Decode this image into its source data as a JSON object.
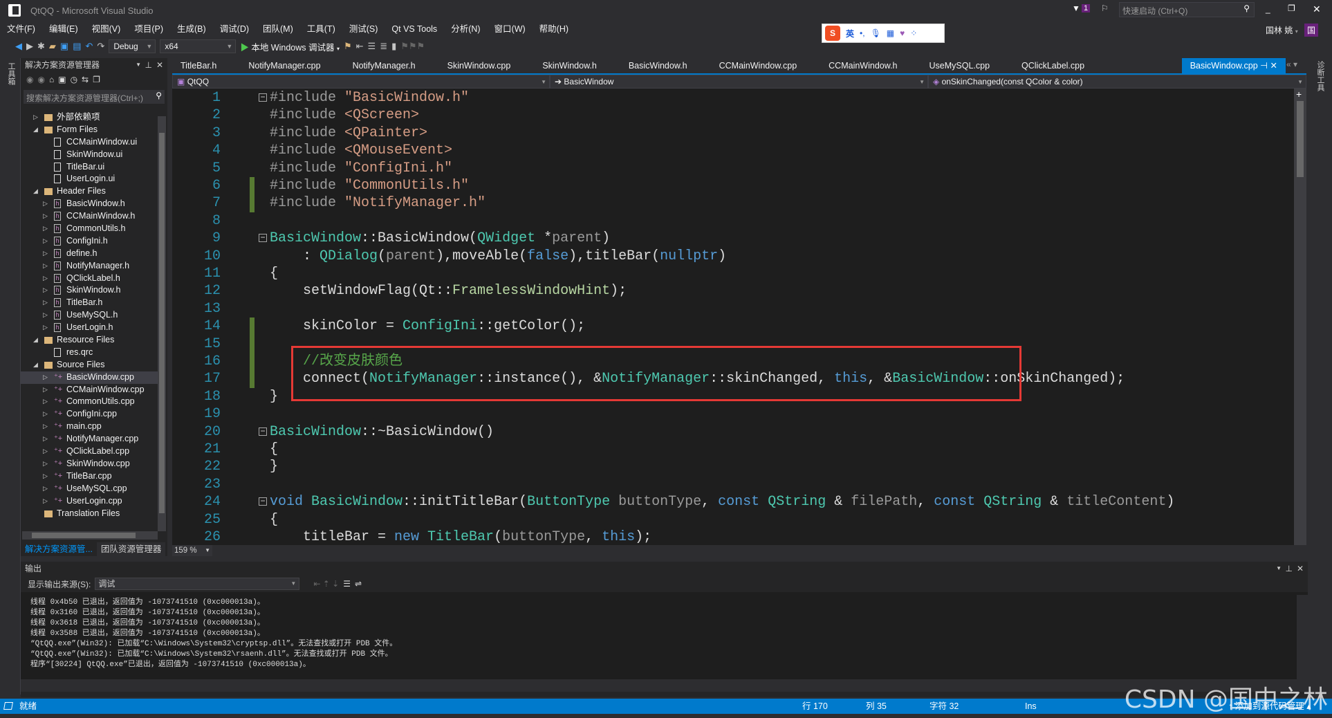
{
  "window": {
    "title": "QtQQ - Microsoft Visual Studio",
    "quick_launch_placeholder": "快速启动 (Ctrl+Q)",
    "notification_count": "1",
    "user": "国林 姚",
    "user_initial": "国"
  },
  "menu": [
    "文件(F)",
    "编辑(E)",
    "视图(V)",
    "项目(P)",
    "生成(B)",
    "调试(D)",
    "团队(M)",
    "工具(T)",
    "测试(S)",
    "Qt VS Tools",
    "分析(N)",
    "窗口(W)",
    "帮助(H)"
  ],
  "toolbar": {
    "config": "Debug",
    "platform": "x64",
    "run_label": "本地 Windows 调试器"
  },
  "ime": {
    "lang": "英"
  },
  "left_strip_label": "工具箱",
  "right_strip_label": "诊断工具",
  "solution_explorer": {
    "title": "解决方案资源管理器",
    "search_placeholder": "搜索解决方案资源管理器(Ctrl+;)",
    "items": [
      {
        "label": "外部依赖项",
        "level": 0,
        "type": "deps",
        "arrow": "closed"
      },
      {
        "label": "Form Files",
        "level": 0,
        "type": "folder",
        "arrow": "open"
      },
      {
        "label": "CCMainWindow.ui",
        "level": 1,
        "type": "ui",
        "arrow": ""
      },
      {
        "label": "SkinWindow.ui",
        "level": 1,
        "type": "ui",
        "arrow": ""
      },
      {
        "label": "TitleBar.ui",
        "level": 1,
        "type": "ui",
        "arrow": ""
      },
      {
        "label": "UserLogin.ui",
        "level": 1,
        "type": "ui",
        "arrow": ""
      },
      {
        "label": "Header Files",
        "level": 0,
        "type": "folder",
        "arrow": "open"
      },
      {
        "label": "BasicWindow.h",
        "level": 1,
        "type": "h",
        "arrow": "closed"
      },
      {
        "label": "CCMainWindow.h",
        "level": 1,
        "type": "h",
        "arrow": "closed"
      },
      {
        "label": "CommonUtils.h",
        "level": 1,
        "type": "h",
        "arrow": "closed"
      },
      {
        "label": "ConfigIni.h",
        "level": 1,
        "type": "h",
        "arrow": "closed"
      },
      {
        "label": "define.h",
        "level": 1,
        "type": "h",
        "arrow": "closed"
      },
      {
        "label": "NotifyManager.h",
        "level": 1,
        "type": "h",
        "arrow": "closed"
      },
      {
        "label": "QClickLabel.h",
        "level": 1,
        "type": "h",
        "arrow": "closed"
      },
      {
        "label": "SkinWindow.h",
        "level": 1,
        "type": "h",
        "arrow": "closed"
      },
      {
        "label": "TitleBar.h",
        "level": 1,
        "type": "h",
        "arrow": "closed"
      },
      {
        "label": "UseMySQL.h",
        "level": 1,
        "type": "h",
        "arrow": "closed"
      },
      {
        "label": "UserLogin.h",
        "level": 1,
        "type": "h",
        "arrow": "closed"
      },
      {
        "label": "Resource Files",
        "level": 0,
        "type": "folder",
        "arrow": "open"
      },
      {
        "label": "res.qrc",
        "level": 1,
        "type": "file",
        "arrow": ""
      },
      {
        "label": "Source Files",
        "level": 0,
        "type": "folder",
        "arrow": "open"
      },
      {
        "label": "BasicWindow.cpp",
        "level": 1,
        "type": "cpp",
        "arrow": "closed",
        "selected": true
      },
      {
        "label": "CCMainWindow.cpp",
        "level": 1,
        "type": "cpp",
        "arrow": "closed"
      },
      {
        "label": "CommonUtils.cpp",
        "level": 1,
        "type": "cpp",
        "arrow": "closed"
      },
      {
        "label": "ConfigIni.cpp",
        "level": 1,
        "type": "cpp",
        "arrow": "closed"
      },
      {
        "label": "main.cpp",
        "level": 1,
        "type": "cpp",
        "arrow": "closed"
      },
      {
        "label": "NotifyManager.cpp",
        "level": 1,
        "type": "cpp",
        "arrow": "closed"
      },
      {
        "label": "QClickLabel.cpp",
        "level": 1,
        "type": "cpp",
        "arrow": "closed"
      },
      {
        "label": "SkinWindow.cpp",
        "level": 1,
        "type": "cpp",
        "arrow": "closed"
      },
      {
        "label": "TitleBar.cpp",
        "level": 1,
        "type": "cpp",
        "arrow": "closed"
      },
      {
        "label": "UseMySQL.cpp",
        "level": 1,
        "type": "cpp",
        "arrow": "closed"
      },
      {
        "label": "UserLogin.cpp",
        "level": 1,
        "type": "cpp",
        "arrow": "closed"
      },
      {
        "label": "Translation Files",
        "level": 0,
        "type": "folder",
        "arrow": ""
      }
    ],
    "bottom_tabs": [
      "解决方案资源管...",
      "团队资源管理器"
    ]
  },
  "tabs": [
    "TitleBar.h",
    "NotifyManager.cpp",
    "NotifyManager.h",
    "SkinWindow.cpp",
    "SkinWindow.h",
    "BasicWindow.h",
    "CCMainWindow.cpp",
    "CCMainWindow.h",
    "UseMySQL.cpp",
    "QClickLabel.cpp",
    "BasicWindow.cpp"
  ],
  "active_tab": "BasicWindow.cpp",
  "navbar": {
    "project": "QtQQ",
    "scope": "BasicWindow",
    "member": "onSkinChanged(const QColor & color)"
  },
  "zoom": "159 %",
  "code": [
    {
      "n": "1",
      "fold": "−",
      "chg": false,
      "t": [
        [
          "#include ",
          "pp"
        ],
        [
          "\"BasicWindow.h\"",
          "st"
        ]
      ]
    },
    {
      "n": "2",
      "chg": false,
      "t": [
        [
          "#include ",
          "pp"
        ],
        [
          "<QScreen>",
          "st"
        ]
      ]
    },
    {
      "n": "3",
      "chg": false,
      "t": [
        [
          "#include ",
          "pp"
        ],
        [
          "<QPainter>",
          "st"
        ]
      ]
    },
    {
      "n": "4",
      "chg": false,
      "t": [
        [
          "#include ",
          "pp"
        ],
        [
          "<QMouseEvent>",
          "st"
        ]
      ]
    },
    {
      "n": "5",
      "chg": false,
      "t": [
        [
          "#include ",
          "pp"
        ],
        [
          "\"ConfigIni.h\"",
          "st"
        ]
      ]
    },
    {
      "n": "6",
      "chg": true,
      "t": [
        [
          "#include ",
          "pp"
        ],
        [
          "\"CommonUtils.h\"",
          "st"
        ]
      ]
    },
    {
      "n": "7",
      "chg": true,
      "t": [
        [
          "#include ",
          "pp"
        ],
        [
          "\"NotifyManager.h\"",
          "st"
        ]
      ]
    },
    {
      "n": "8",
      "chg": false,
      "t": []
    },
    {
      "n": "9",
      "fold": "−",
      "chg": false,
      "t": [
        [
          "BasicWindow",
          "ty"
        ],
        [
          "::BasicWindow(",
          ""
        ],
        [
          "QWidget",
          "ty"
        ],
        [
          " *",
          ""
        ],
        [
          "parent",
          "pa"
        ],
        [
          ")",
          ""
        ]
      ]
    },
    {
      "n": "10",
      "chg": false,
      "t": [
        [
          "    : ",
          ""
        ],
        [
          "QDialog",
          "ty"
        ],
        [
          "(",
          ""
        ],
        [
          "parent",
          "pa"
        ],
        [
          "),moveAble(",
          ""
        ],
        [
          "false",
          "kw"
        ],
        [
          "),titleBar(",
          ""
        ],
        [
          "nullptr",
          "kw"
        ],
        [
          ")",
          ""
        ]
      ]
    },
    {
      "n": "11",
      "chg": false,
      "t": [
        [
          "{",
          ""
        ]
      ]
    },
    {
      "n": "12",
      "chg": false,
      "t": [
        [
          "    setWindowFlag(Qt::",
          ""
        ],
        [
          "FramelessWindowHint",
          "en"
        ],
        [
          ");",
          ""
        ]
      ]
    },
    {
      "n": "13",
      "chg": false,
      "t": []
    },
    {
      "n": "14",
      "chg": true,
      "t": [
        [
          "    skinColor = ",
          ""
        ],
        [
          "ConfigIni",
          "ty"
        ],
        [
          "::getColor();",
          ""
        ]
      ]
    },
    {
      "n": "15",
      "chg": true,
      "t": []
    },
    {
      "n": "16",
      "chg": true,
      "t": [
        [
          "    ",
          ""
        ],
        [
          "//改变皮肤颜色",
          "cm"
        ]
      ]
    },
    {
      "n": "17",
      "chg": true,
      "t": [
        [
          "    connect(",
          ""
        ],
        [
          "NotifyManager",
          "ty"
        ],
        [
          "::instance(), &",
          ""
        ],
        [
          "NotifyManager",
          "ty"
        ],
        [
          "::skinChanged, ",
          ""
        ],
        [
          "this",
          "kw"
        ],
        [
          ", &",
          ""
        ],
        [
          "BasicWindow",
          "ty"
        ],
        [
          "::onSkinChanged);",
          ""
        ]
      ]
    },
    {
      "n": "18",
      "chg": false,
      "t": [
        [
          "}",
          ""
        ]
      ]
    },
    {
      "n": "19",
      "chg": false,
      "t": []
    },
    {
      "n": "20",
      "fold": "−",
      "chg": false,
      "t": [
        [
          "BasicWindow",
          "ty"
        ],
        [
          "::~BasicWindow()",
          ""
        ]
      ]
    },
    {
      "n": "21",
      "chg": false,
      "t": [
        [
          "{",
          ""
        ]
      ]
    },
    {
      "n": "22",
      "chg": false,
      "t": [
        [
          "}",
          ""
        ]
      ]
    },
    {
      "n": "23",
      "chg": false,
      "t": []
    },
    {
      "n": "24",
      "fold": "−",
      "chg": false,
      "t": [
        [
          "void ",
          "kw"
        ],
        [
          "BasicWindow",
          "ty"
        ],
        [
          "::initTitleBar(",
          ""
        ],
        [
          "ButtonType",
          "ty"
        ],
        [
          " ",
          ""
        ],
        [
          "buttonType",
          "pa"
        ],
        [
          ", ",
          ""
        ],
        [
          "const ",
          "kw"
        ],
        [
          "QString",
          "ty"
        ],
        [
          " & ",
          ""
        ],
        [
          "filePath",
          "pa"
        ],
        [
          ", ",
          ""
        ],
        [
          "const ",
          "kw"
        ],
        [
          "QString",
          "ty"
        ],
        [
          " & ",
          ""
        ],
        [
          "titleContent",
          "pa"
        ],
        [
          ")",
          ""
        ]
      ]
    },
    {
      "n": "25",
      "chg": false,
      "t": [
        [
          "{",
          ""
        ]
      ]
    },
    {
      "n": "26",
      "chg": false,
      "t": [
        [
          "    titleBar = ",
          ""
        ],
        [
          "new ",
          "kw"
        ],
        [
          "TitleBar",
          "ty"
        ],
        [
          "(",
          ""
        ],
        [
          "buttonType",
          "pa"
        ],
        [
          ", ",
          ""
        ],
        [
          "this",
          "kw"
        ],
        [
          ");",
          ""
        ]
      ]
    }
  ],
  "output": {
    "title": "输出",
    "source_label": "显示输出来源(S):",
    "source_value": "调试",
    "lines": [
      "线程 0x4b50 已退出，返回值为 -1073741510 (0xc000013a)。",
      "线程 0x3160 已退出，返回值为 -1073741510 (0xc000013a)。",
      "线程 0x3618 已退出，返回值为 -1073741510 (0xc000013a)。",
      "线程 0x3588 已退出，返回值为 -1073741510 (0xc000013a)。",
      "“QtQQ.exe”(Win32): 已加载“C:\\Windows\\System32\\cryptsp.dll”。无法查找或打开 PDB 文件。",
      "“QtQQ.exe”(Win32): 已加载“C:\\Windows\\System32\\rsaenh.dll”。无法查找或打开 PDB 文件。",
      "程序“[30224] QtQQ.exe”已退出，返回值为 -1073741510 (0xc000013a)。"
    ]
  },
  "status": {
    "ready": "就绪",
    "line": "行 170",
    "col": "列 35",
    "char": "字符 32",
    "mode": "Ins",
    "source_control": "添加到源代码管理"
  },
  "watermark": "CSDN @国中之林",
  "colors": {
    "accent": "#007acc",
    "editor_bg": "#1e1e1e",
    "highlight_box": "#e53935"
  }
}
